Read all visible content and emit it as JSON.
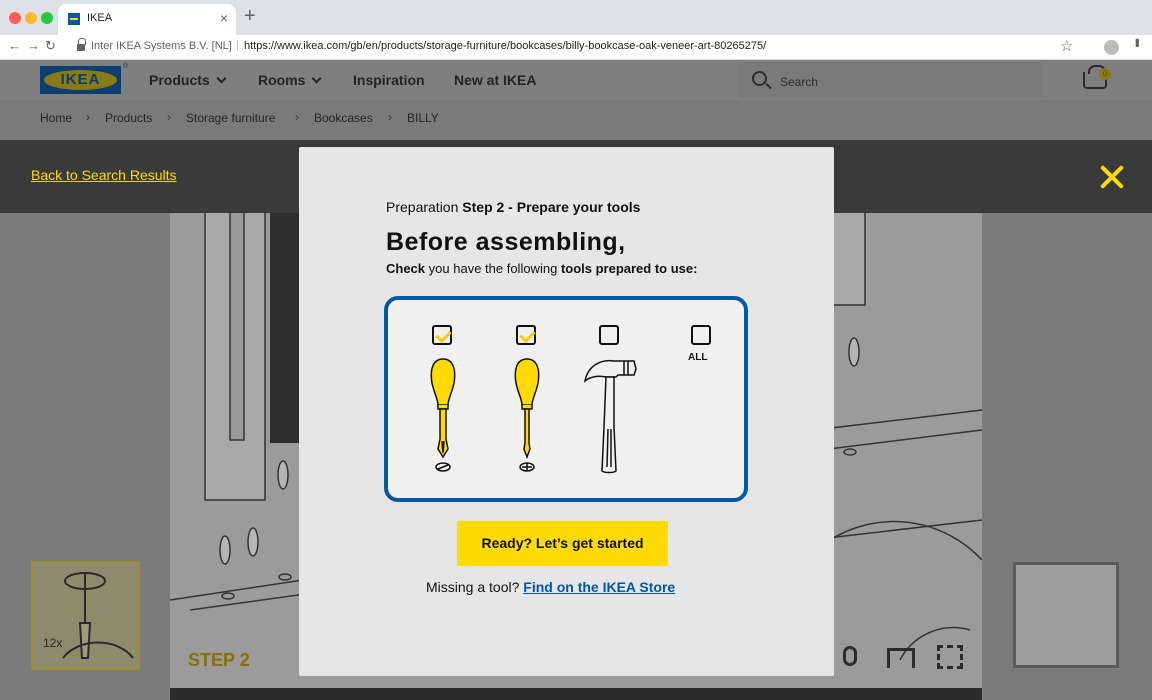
{
  "browser": {
    "tab_title": "IKEA",
    "tab_close": "×",
    "new_tab": "+",
    "cert": "Inter IKEA Systems B.V. [NL]",
    "url": "https://www.ikea.com/gb/en/products/storage-furniture/bookcases/billy-bookcase-oak-veneer-art-80265275/"
  },
  "header": {
    "logo_text": "IKEA",
    "nav": [
      "Products",
      "Rooms",
      "Inspiration",
      "New at IKEA"
    ],
    "search_placeholder": "Search",
    "cart_count": "0"
  },
  "breadcrumb": [
    "Home",
    "Products",
    "Storage furniture",
    "Bookcases",
    "BILLY"
  ],
  "stage": {
    "back_link": "Back to Search Results",
    "step_label": "STEP 2",
    "thumb_count": "12x"
  },
  "modal": {
    "prep_prefix": "Preparation",
    "prep_step": "Step 2 - Prepare your tools",
    "title": "Before assembling,",
    "sub_check": "Check",
    "sub_mid": "you have the following",
    "sub_tools": "tools prepared to use:",
    "tools": [
      {
        "name": "Flathead screwdriver",
        "checked": true,
        "icon": "flathead-screwdriver-icon"
      },
      {
        "name": "Phillips screwdriver",
        "checked": true,
        "icon": "phillips-screwdriver-icon"
      },
      {
        "name": "Hammer",
        "checked": false,
        "icon": "hammer-icon"
      }
    ],
    "all_label": "ALL",
    "all_checked": false,
    "cta_label": "Ready? Let’s get started",
    "missing_text": "Missing a tool?",
    "store_link": "Find on the IKEA Store"
  },
  "colors": {
    "ikea_blue": "#0058a3",
    "ikea_yellow": "#ffdb00"
  }
}
